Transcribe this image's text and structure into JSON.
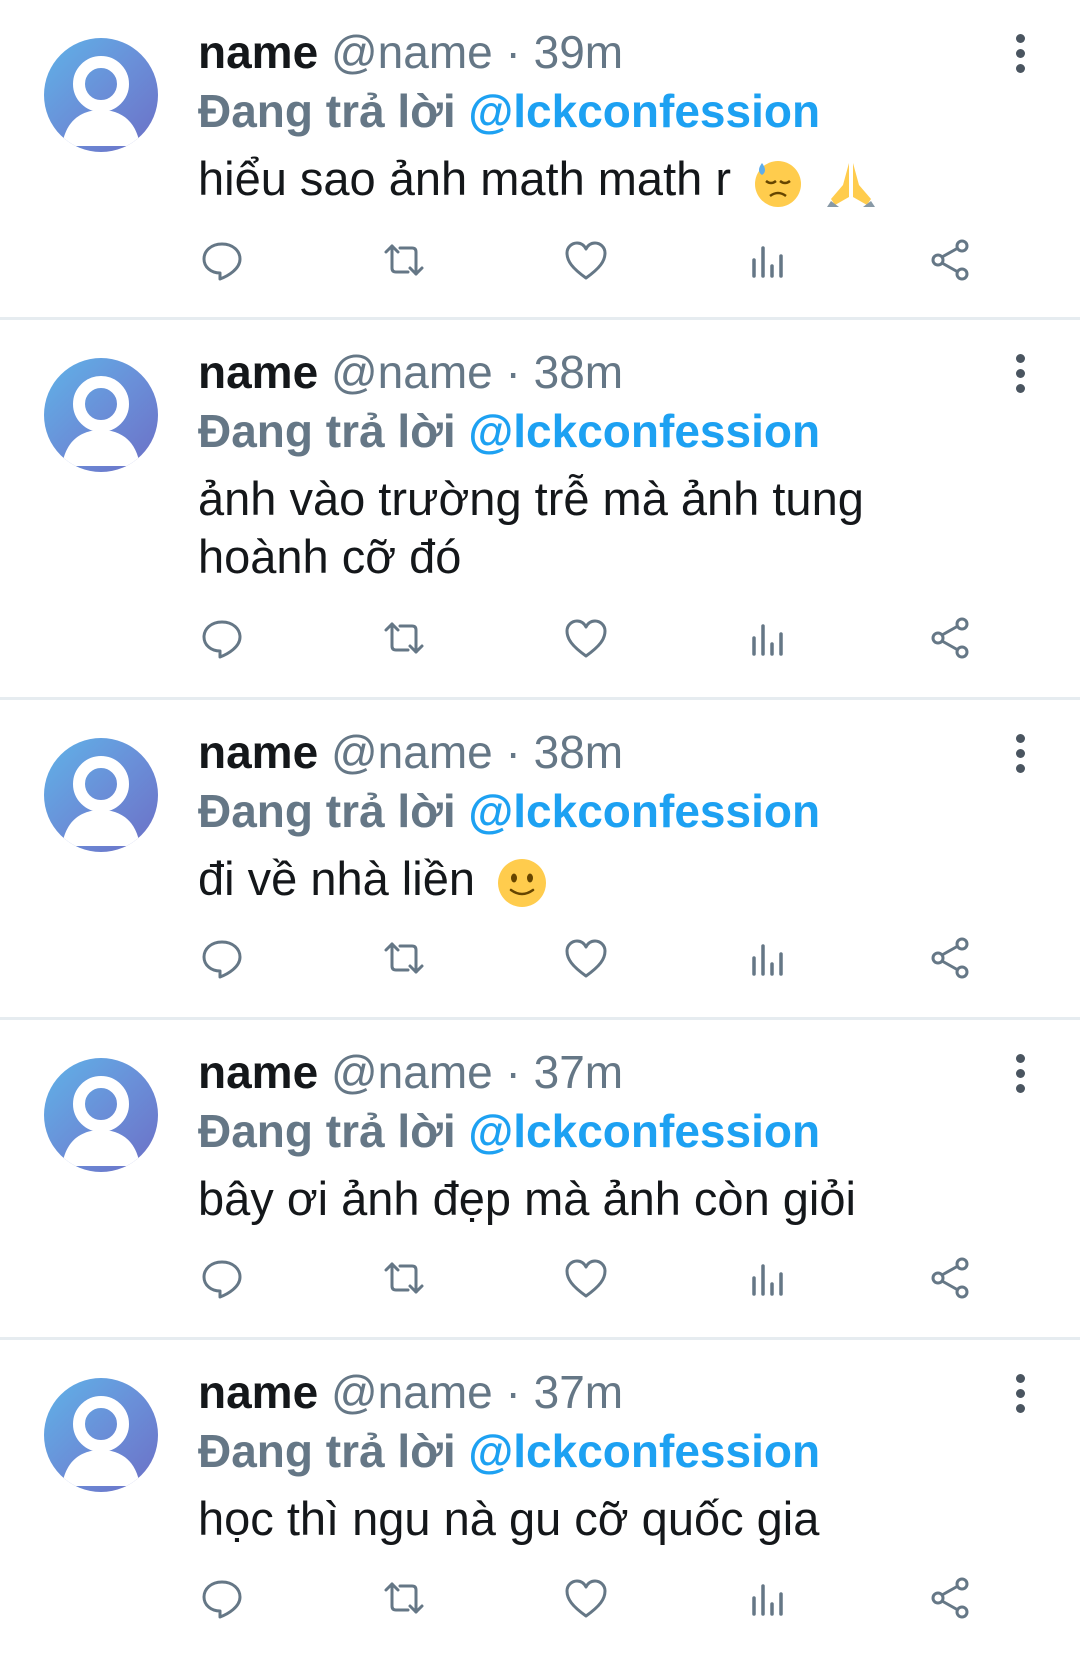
{
  "tweets": [
    {
      "display_name": "name",
      "handle": "@name",
      "separator": "·",
      "time": "39m",
      "reply_prefix": "Đang trả lời",
      "reply_target": "@lckconfession",
      "text": "hiểu sao ảnh math math r",
      "emojis": [
        "downcast-sweat-emoji",
        "folded-hands-emoji"
      ]
    },
    {
      "display_name": "name",
      "handle": "@name",
      "separator": "·",
      "time": "38m",
      "reply_prefix": "Đang trả lời",
      "reply_target": "@lckconfession",
      "text": "ảnh vào trường trễ mà ảnh tung hoành cỡ đó",
      "emojis": []
    },
    {
      "display_name": "name",
      "handle": "@name",
      "separator": "·",
      "time": "38m",
      "reply_prefix": "Đang trả lời",
      "reply_target": "@lckconfession",
      "text": "đi về nhà liền",
      "emojis": [
        "slightly-smiling-face-emoji"
      ]
    },
    {
      "display_name": "name",
      "handle": "@name",
      "separator": "·",
      "time": "37m",
      "reply_prefix": "Đang trả lời",
      "reply_target": "@lckconfession",
      "text": "bây ơi ảnh đẹp mà ảnh còn giỏi",
      "emojis": []
    },
    {
      "display_name": "name",
      "handle": "@name",
      "separator": "·",
      "time": "37m",
      "reply_prefix": "Đang trả lời",
      "reply_target": "@lckconfession",
      "text": "học thì ngu nà gu cỡ quốc gia",
      "emojis": []
    }
  ],
  "icons": {
    "reply": "reply-icon",
    "retweet": "retweet-icon",
    "like": "heart-icon",
    "stats": "stats-icon",
    "share": "share-icon",
    "more": "more-vertical-icon"
  },
  "colors": {
    "link_blue": "#1da1f2",
    "muted_gray": "#657786",
    "text_dark": "#14171a",
    "icon_gray": "#657786",
    "divider": "#e6ecf0"
  }
}
